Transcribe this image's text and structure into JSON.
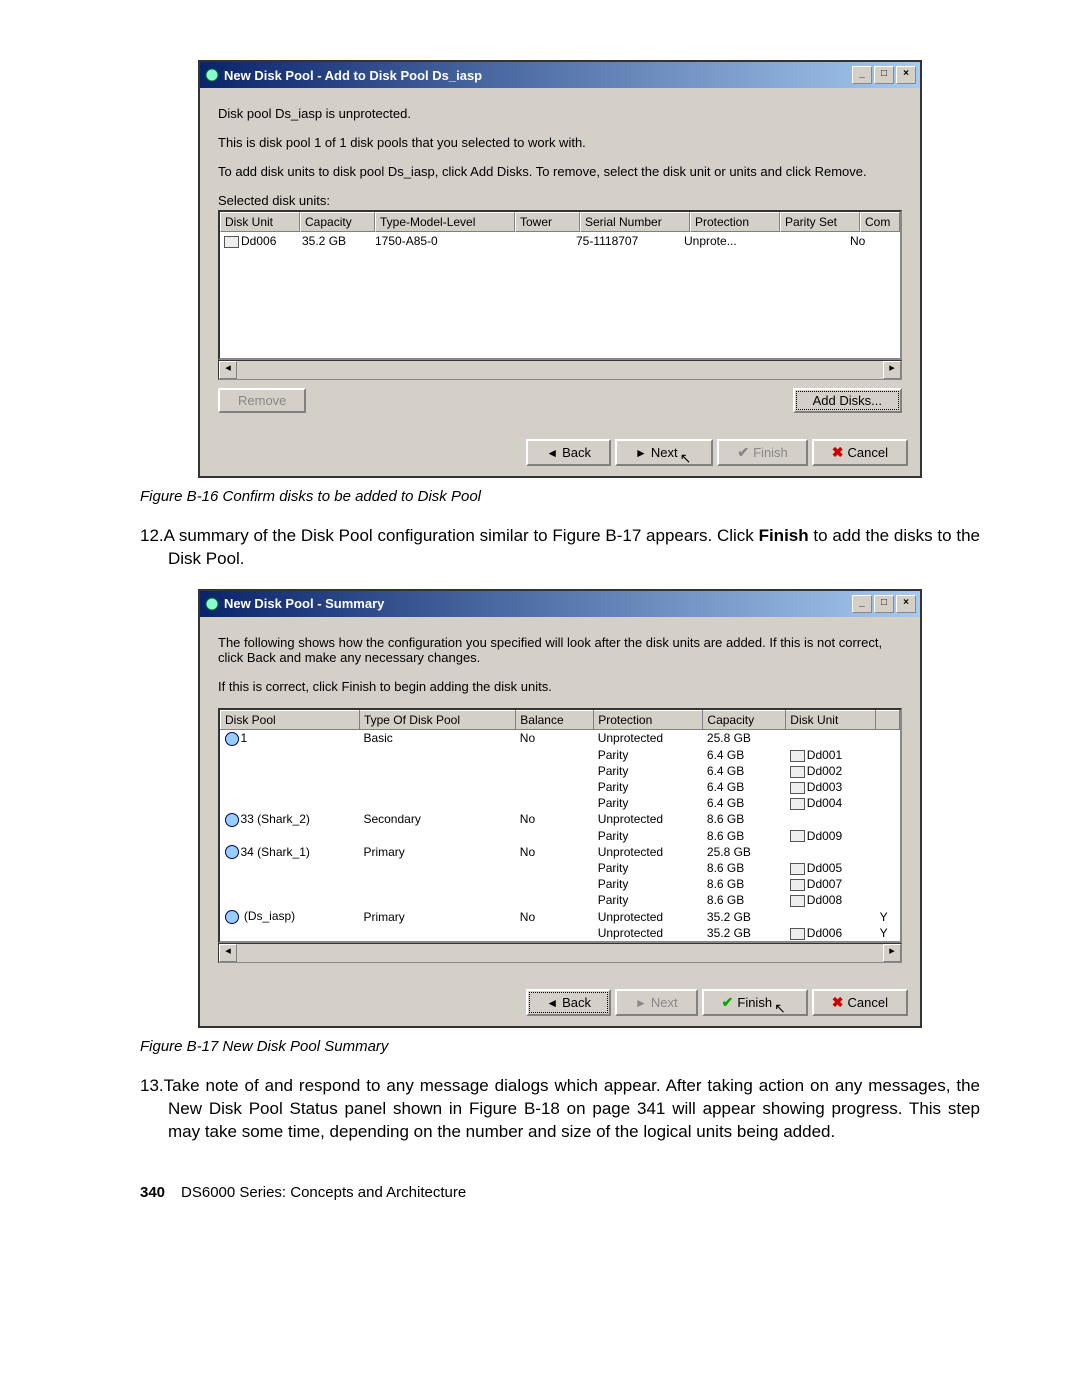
{
  "dialog1": {
    "title": "New Disk Pool - Add to Disk Pool Ds_iasp",
    "line1": "Disk pool Ds_iasp is unprotected.",
    "line2": "This is disk pool 1 of 1 disk pools that you selected to work with.",
    "line3": "To add disk units to disk pool Ds_iasp, click Add Disks. To remove, select the disk unit or units and click Remove.",
    "selected_label": "Selected disk units:",
    "headers": [
      "Disk Unit",
      "Capacity",
      "Type-Model-Level",
      "Tower",
      "Serial Number",
      "Protection",
      "Parity Set",
      "Com"
    ],
    "row": [
      "Dd006",
      "35.2 GB",
      "1750-A85-0",
      "",
      "75-1118707",
      "Unprote...",
      "",
      "No"
    ],
    "remove_btn": "Remove",
    "add_btn": "Add Disks...",
    "back_btn": "Back",
    "next_btn": "Next",
    "finish_btn": "Finish",
    "cancel_btn": "Cancel"
  },
  "caption1": "Figure B-16   Confirm disks to be added to Disk Pool",
  "step12_num": "12.",
  "step12": "A summary of the Disk Pool configuration similar to Figure B-17 appears. Click ",
  "step12_bold": "Finish",
  "step12_tail": " to add the disks to the Disk Pool.",
  "dialog2": {
    "title": "New Disk Pool - Summary",
    "line1": "The following shows how the configuration you specified will look after the disk units are added.  If this is not correct, click Back and make any necessary changes.",
    "line2": "If this is correct, click Finish to begin adding the disk units.",
    "headers": [
      "Disk Pool",
      "Type Of Disk Pool",
      "Balance",
      "Protection",
      "Capacity",
      "Disk Unit",
      ""
    ],
    "rows": [
      {
        "pool_icon": true,
        "pool": "1",
        "type": "Basic",
        "balance": "No",
        "prot": "Unprotected",
        "cap": "25.8 GB",
        "du_icon": false,
        "du": "",
        "extra": ""
      },
      {
        "pool_icon": false,
        "pool": "",
        "type": "",
        "balance": "",
        "prot": "Parity",
        "cap": "6.4 GB",
        "du_icon": true,
        "du": "Dd001",
        "extra": ""
      },
      {
        "pool_icon": false,
        "pool": "",
        "type": "",
        "balance": "",
        "prot": "Parity",
        "cap": "6.4 GB",
        "du_icon": true,
        "du": "Dd002",
        "extra": ""
      },
      {
        "pool_icon": false,
        "pool": "",
        "type": "",
        "balance": "",
        "prot": "Parity",
        "cap": "6.4 GB",
        "du_icon": true,
        "du": "Dd003",
        "extra": ""
      },
      {
        "pool_icon": false,
        "pool": "",
        "type": "",
        "balance": "",
        "prot": "Parity",
        "cap": "6.4 GB",
        "du_icon": true,
        "du": "Dd004",
        "extra": ""
      },
      {
        "pool_icon": true,
        "pool": "33 (Shark_2)",
        "type": "Secondary",
        "balance": "No",
        "prot": "Unprotected",
        "cap": "8.6 GB",
        "du_icon": false,
        "du": "",
        "extra": ""
      },
      {
        "pool_icon": false,
        "pool": "",
        "type": "",
        "balance": "",
        "prot": "Parity",
        "cap": "8.6 GB",
        "du_icon": true,
        "du": "Dd009",
        "extra": ""
      },
      {
        "pool_icon": true,
        "pool": "34 (Shark_1)",
        "type": "Primary",
        "balance": "No",
        "prot": "Unprotected",
        "cap": "25.8 GB",
        "du_icon": false,
        "du": "",
        "extra": ""
      },
      {
        "pool_icon": false,
        "pool": "",
        "type": "",
        "balance": "",
        "prot": "Parity",
        "cap": "8.6 GB",
        "du_icon": true,
        "du": "Dd005",
        "extra": ""
      },
      {
        "pool_icon": false,
        "pool": "",
        "type": "",
        "balance": "",
        "prot": "Parity",
        "cap": "8.6 GB",
        "du_icon": true,
        "du": "Dd007",
        "extra": ""
      },
      {
        "pool_icon": false,
        "pool": "",
        "type": "",
        "balance": "",
        "prot": "Parity",
        "cap": "8.6 GB",
        "du_icon": true,
        "du": "Dd008",
        "extra": ""
      },
      {
        "pool_icon": true,
        "pool": "     (Ds_iasp)",
        "type": "Primary",
        "balance": "No",
        "prot": "Unprotected",
        "cap": "35.2 GB",
        "du_icon": false,
        "du": "",
        "extra": "Y"
      },
      {
        "pool_icon": false,
        "pool": "",
        "type": "",
        "balance": "",
        "prot": "Unprotected",
        "cap": "35.2 GB",
        "du_icon": true,
        "du": "Dd006",
        "extra": "Y"
      }
    ],
    "back_btn": "Back",
    "next_btn": "Next",
    "finish_btn": "Finish",
    "cancel_btn": "Cancel"
  },
  "caption2": "Figure B-17   New Disk Pool Summary",
  "step13_num": "13.",
  "step13": "Take note of and respond to any message dialogs which appear. After taking action on any messages, the New Disk Pool Status panel shown in Figure B-18 on page 341 will appear showing progress. This step may take some time, depending on the number and size of the logical units being added.",
  "footer_page": "340",
  "footer_text": "DS6000 Series: Concepts and Architecture"
}
